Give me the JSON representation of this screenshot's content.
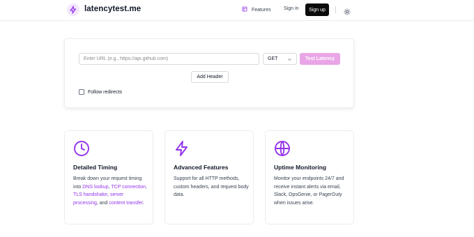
{
  "colors": {
    "accent": "#9333ea",
    "test_button": "#e9a5e6",
    "signup_bg": "#0b0b0b"
  },
  "header": {
    "brand": "latencytest.me",
    "logo_icon": "lightning-bolt-icon",
    "nav": {
      "features": "Features",
      "features_icon": "layout-icon",
      "signin": "Sign in",
      "signup": "Sign up"
    },
    "theme_icon": "sun-icon"
  },
  "tester": {
    "url_placeholder": "Enter URL (e.g., https://api.github.com)",
    "url_value": "",
    "method": "GET",
    "test_button": "Test Latency",
    "add_header": "Add Header",
    "follow_redirects": "Follow redirects",
    "follow_redirects_checked": false
  },
  "features": [
    {
      "icon": "clock-icon",
      "title": "Detailed Timing",
      "desc_parts": [
        {
          "t": "Break down your request timing into ",
          "hl": false
        },
        {
          "t": "DNS lookup",
          "hl": true
        },
        {
          "t": ", ",
          "hl": false
        },
        {
          "t": "TCP connection",
          "hl": true
        },
        {
          "t": ", ",
          "hl": false
        },
        {
          "t": "TLS handshake",
          "hl": true
        },
        {
          "t": ", ",
          "hl": false
        },
        {
          "t": "server processing",
          "hl": true
        },
        {
          "t": ", and ",
          "hl": false
        },
        {
          "t": "content transfer",
          "hl": true
        },
        {
          "t": ".",
          "hl": false
        }
      ]
    },
    {
      "icon": "zap-icon",
      "title": "Advanced Features",
      "desc_parts": [
        {
          "t": "Support for all HTTP methods, custom headers, and request body data.",
          "hl": false
        }
      ]
    },
    {
      "icon": "globe-icon",
      "title": "Uptime Monitoring",
      "desc_parts": [
        {
          "t": "Monitor your endpoints 24/7 and receive instant alerts via email, Slack, OpsGenie, or PagerDuty when issues arise.",
          "hl": false
        }
      ]
    }
  ]
}
